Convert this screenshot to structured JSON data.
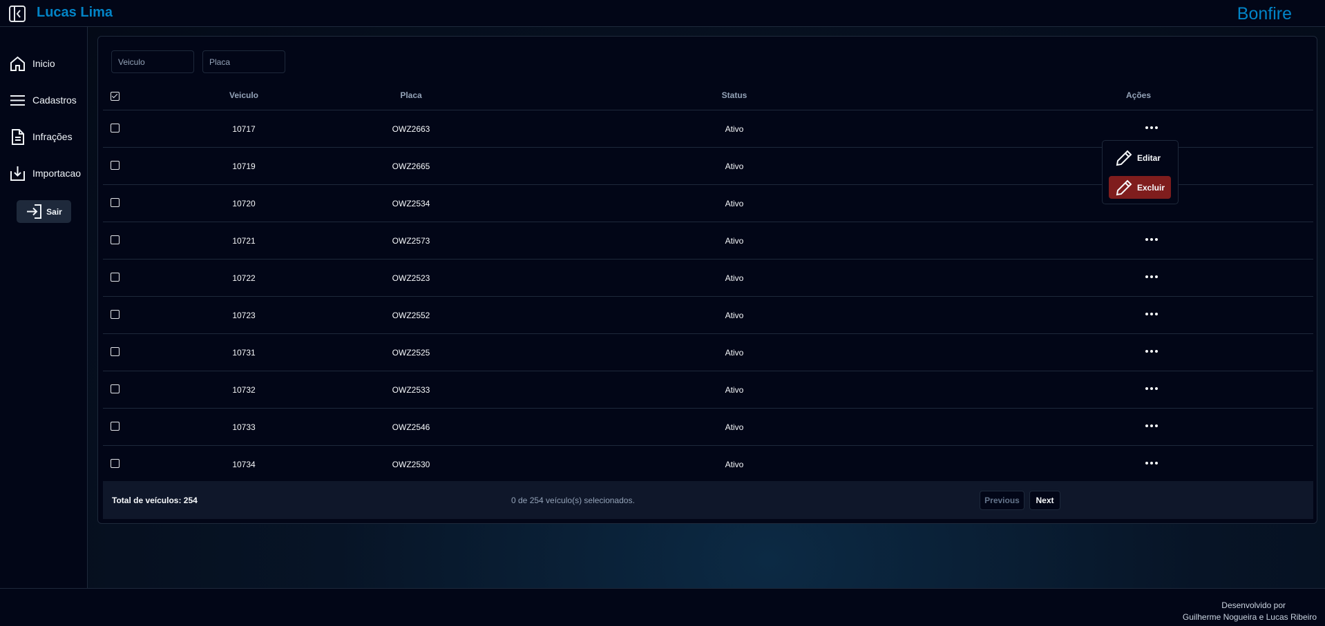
{
  "header": {
    "user_name": "Lucas Lima",
    "brand": "Bonfire",
    "brand_color": "#0284c7"
  },
  "sidebar": {
    "items": [
      {
        "label": "Inicio",
        "icon": "home-icon"
      },
      {
        "label": "Cadastros",
        "icon": "menu-icon"
      },
      {
        "label": "Infrações",
        "icon": "document-icon"
      },
      {
        "label": "Importacao",
        "icon": "import-icon"
      }
    ],
    "logout_label": "Sair"
  },
  "filters": {
    "vehicle_placeholder": "Veiculo",
    "plate_placeholder": "Placa"
  },
  "table": {
    "columns": [
      "Veiculo",
      "Placa",
      "Status",
      "Ações"
    ],
    "header_checkbox_checked": true,
    "rows": [
      {
        "vehicle": "10717",
        "plate": "OWZ2663",
        "status": "Ativo"
      },
      {
        "vehicle": "10719",
        "plate": "OWZ2665",
        "status": "Ativo"
      },
      {
        "vehicle": "10720",
        "plate": "OWZ2534",
        "status": "Ativo"
      },
      {
        "vehicle": "10721",
        "plate": "OWZ2573",
        "status": "Ativo"
      },
      {
        "vehicle": "10722",
        "plate": "OWZ2523",
        "status": "Ativo"
      },
      {
        "vehicle": "10723",
        "plate": "OWZ2552",
        "status": "Ativo"
      },
      {
        "vehicle": "10731",
        "plate": "OWZ2525",
        "status": "Ativo"
      },
      {
        "vehicle": "10732",
        "plate": "OWZ2533",
        "status": "Ativo"
      },
      {
        "vehicle": "10733",
        "plate": "OWZ2546",
        "status": "Ativo"
      },
      {
        "vehicle": "10734",
        "plate": "OWZ2530",
        "status": "Ativo"
      }
    ]
  },
  "actions_menu": {
    "edit_label": "Editar",
    "delete_label": "Excluir",
    "delete_color": "#7f1d1d"
  },
  "table_footer": {
    "total": "Total de veículos: 254",
    "selected": "0 de 254 veículo(s) selecionados.",
    "previous_label": "Previous",
    "next_label": "Next"
  },
  "footer": {
    "line1": "Desenvolvido por",
    "line2": "Guilherme Nogueira e Lucas Ribeiro"
  }
}
